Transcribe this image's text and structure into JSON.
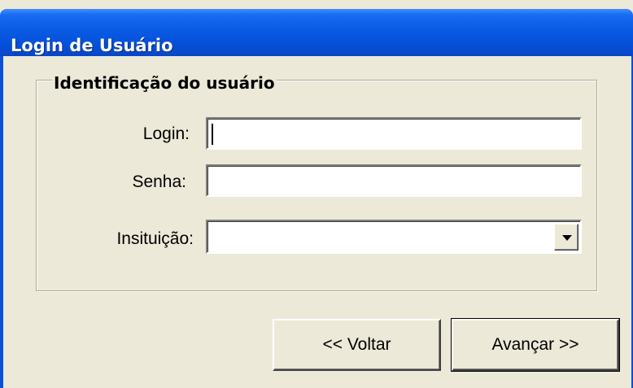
{
  "window": {
    "title": "Login de Usuário"
  },
  "group": {
    "title": "Identificação do usuário",
    "login_label": "Login:",
    "login_value": "",
    "senha_label": "Senha:",
    "senha_value": "",
    "instituicao_label": "Insituição:",
    "instituicao_value": ""
  },
  "buttons": {
    "back_label": "<< Voltar",
    "next_label": "Avançar >>"
  },
  "icons": {
    "dropdown": "chevron-down-icon"
  },
  "colors": {
    "titlebar": "#0a5ce6",
    "dialog_bg": "#ece9d8"
  }
}
